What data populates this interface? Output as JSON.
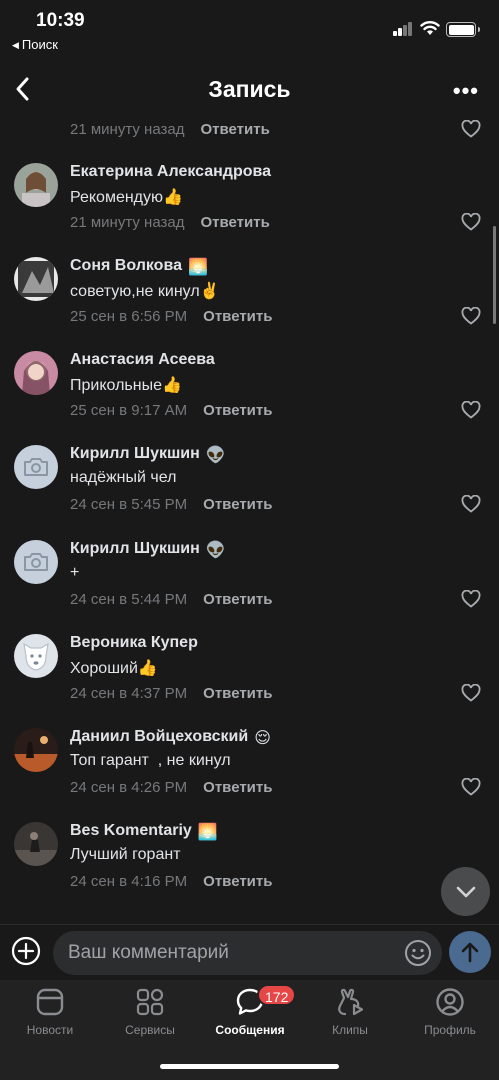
{
  "status_bar": {
    "time": "10:39",
    "back_app": "Поиск"
  },
  "header": {
    "title": "Запись"
  },
  "top_meta": {
    "time": "21 минуту назад",
    "reply": "Ответить"
  },
  "comments": [
    {
      "author": "Екатерина Александрова",
      "text": "Рекомендую👍",
      "time": "21 минуту назад",
      "reply": "Ответить",
      "author_icon": "",
      "avatar": "photo-woman"
    },
    {
      "author": "Соня Волкова",
      "text": "советую,не кинул✌️",
      "time": "25 сен в 6:56 PM",
      "reply": "Ответить",
      "author_icon": "🌅",
      "avatar": "photo-bw"
    },
    {
      "author": "Анастасия Асеева",
      "text": "Прикольные👍",
      "time": "25 сен в 9:17 AM",
      "reply": "Ответить",
      "author_icon": "",
      "avatar": "photo-pink"
    },
    {
      "author": "Кирилл Шукшин",
      "text": "надёжный чел",
      "time": "24 сен в 5:45 PM",
      "reply": "Ответить",
      "author_icon": "👽",
      "avatar": "camera-placeholder"
    },
    {
      "author": "Кирилл Шукшин",
      "text": "+",
      "time": "24 сен в 5:44 PM",
      "reply": "Ответить",
      "author_icon": "👽",
      "avatar": "camera-placeholder"
    },
    {
      "author": "Вероника Купер",
      "text": "Хороший👍",
      "time": "24 сен в 4:37 PM",
      "reply": "Ответить",
      "author_icon": "",
      "avatar": "dog-placeholder"
    },
    {
      "author": "Даниил Войцеховский",
      "text": "Топ гарант  , не кинул",
      "time": "24 сен в 4:26 PM",
      "reply": "Ответить",
      "author_icon": "😌",
      "avatar": "photo-night"
    },
    {
      "author": "Bes Komentariy",
      "text": "Лучший горант",
      "time": "24 сен в 4:16 PM",
      "reply": "Ответить",
      "author_icon": "🌅",
      "avatar": "photo-dark"
    }
  ],
  "composer": {
    "placeholder": "Ваш комментарий"
  },
  "tabbar": {
    "tabs": [
      {
        "label": "Новости",
        "icon": "news-icon"
      },
      {
        "label": "Сервисы",
        "icon": "services-icon"
      },
      {
        "label": "Сообщения",
        "icon": "messages-icon",
        "badge": "172",
        "active": true
      },
      {
        "label": "Клипы",
        "icon": "clips-icon"
      },
      {
        "label": "Профиль",
        "icon": "profile-icon"
      }
    ]
  },
  "colors": {
    "background": "#19191a",
    "accent": "#4a6a8f",
    "badge": "#e64646",
    "muted_text": "#76787a"
  }
}
